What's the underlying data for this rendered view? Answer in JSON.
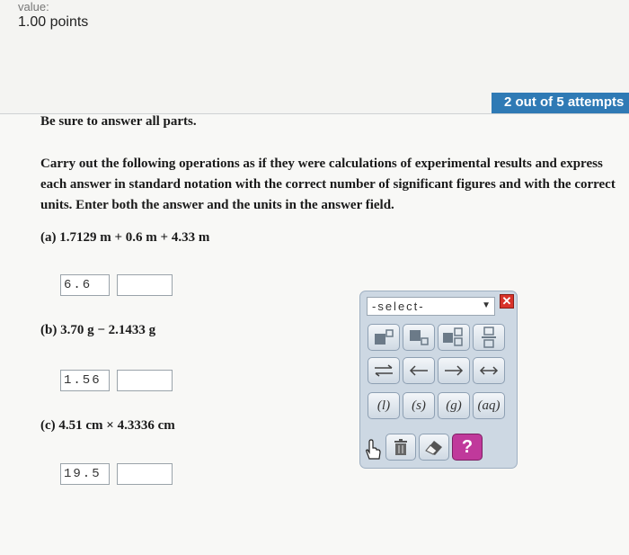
{
  "header": {
    "value_label": "value:",
    "points": "1.00 points"
  },
  "attempts": "2 out of 5 attempts",
  "question": {
    "be_sure": "Be sure to answer all parts.",
    "instructions": "Carry out the following operations as if they were calculations of experimental results and express each answer in standard notation with the correct number of significant figures and with the correct units. Enter both the answer and the units in the answer field.",
    "parts": [
      {
        "label": "(a) 1.7129 m + 0.6 m + 4.33 m",
        "answer": "6.6",
        "units": ""
      },
      {
        "label": "(b) 3.70 g − 2.1433 g",
        "answer": "1.56",
        "units": ""
      },
      {
        "label": "(c) 4.51 cm × 4.3336 cm",
        "answer": "19.5",
        "units": ""
      }
    ]
  },
  "palette": {
    "select_label": "-select-",
    "close_icon": "close-icon",
    "row1_icons": [
      "subscript-superscript-icon",
      "subscript-icon",
      "superscript-stack-icon",
      "fraction-icon"
    ],
    "row2_icons": [
      "equilibrium-arrow-icon",
      "left-arrow-icon",
      "right-arrow-icon",
      "double-arrow-icon"
    ],
    "states": [
      "(l)",
      "(s)",
      "(g)",
      "(aq)"
    ],
    "bottom_icons": [
      "hand-cursor-icon",
      "trash-icon",
      "eraser-icon",
      "help-icon"
    ],
    "help_label": "?"
  },
  "colors": {
    "attempt_badge": "#2f7ab5",
    "close_button": "#d8332a",
    "help_button": "#c0399b"
  }
}
